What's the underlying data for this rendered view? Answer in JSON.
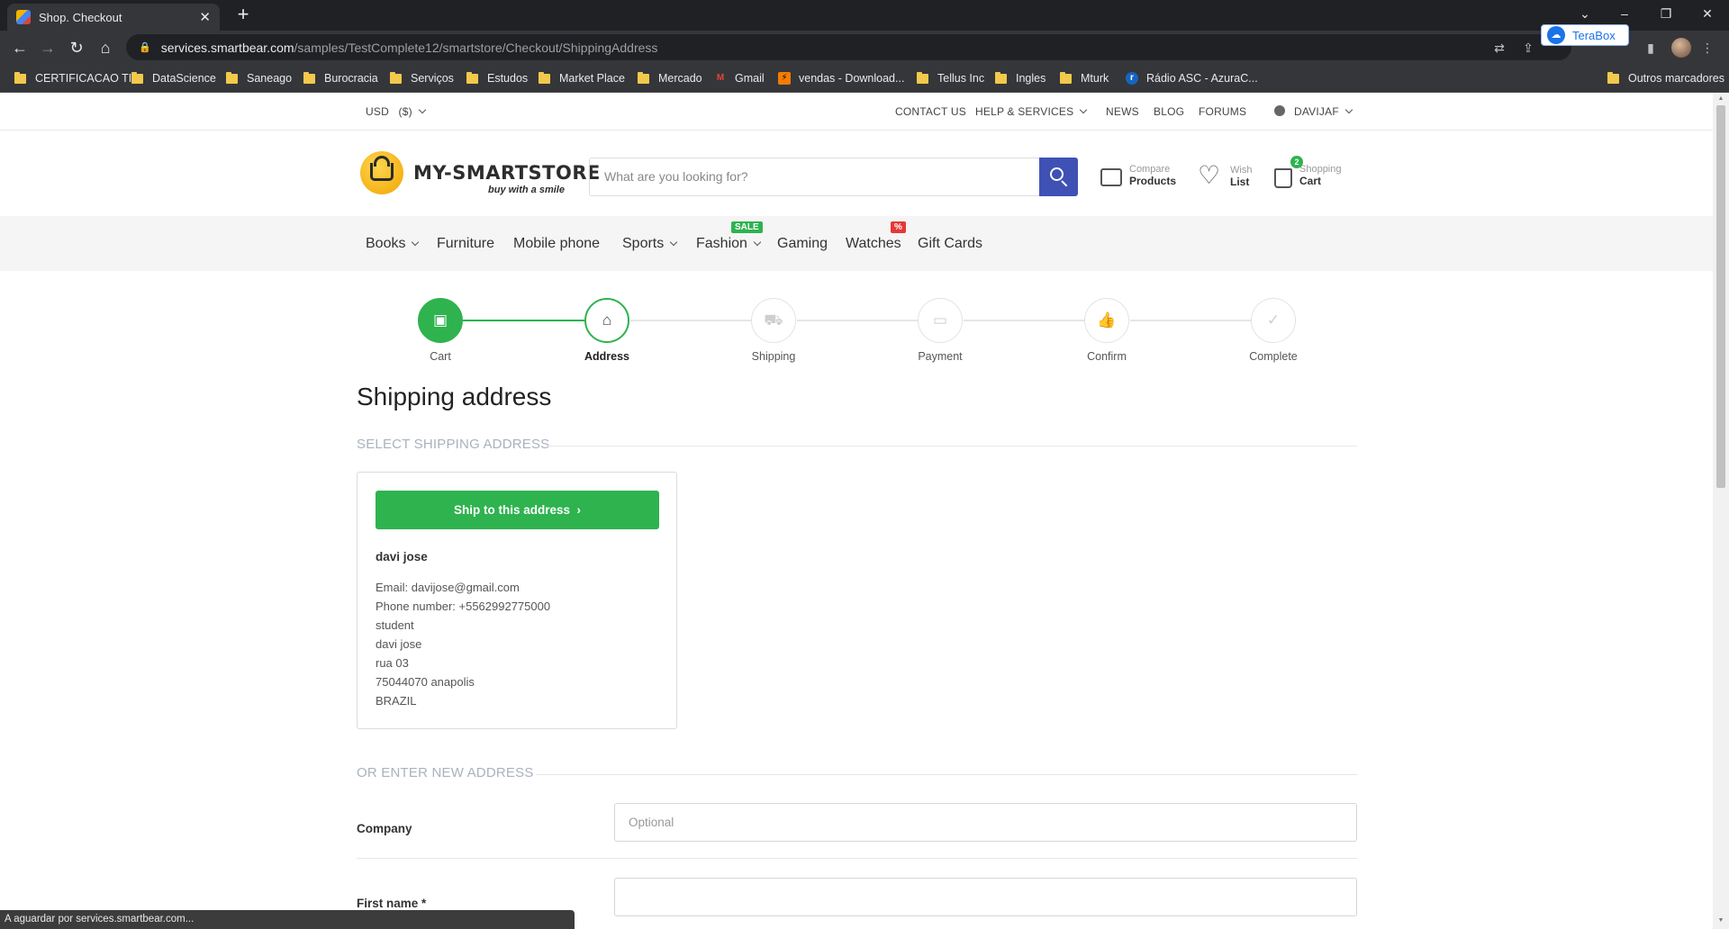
{
  "browser": {
    "tab_title": "Shop. Checkout",
    "url_host": "services.smartbear.com",
    "url_path": "/samples/TestComplete12/smartstore/Checkout/ShippingAddress",
    "extension_label": "TeraBox",
    "status_text": "A aguardar por services.smartbear.com...",
    "bookmarks": [
      {
        "label": "CERTIFICACAO TI",
        "icon": "folder-icon"
      },
      {
        "label": "DataScience",
        "icon": "folder-icon"
      },
      {
        "label": "Saneago",
        "icon": "folder-icon"
      },
      {
        "label": "Burocracia",
        "icon": "folder-icon"
      },
      {
        "label": "Serviços",
        "icon": "folder-icon"
      },
      {
        "label": "Estudos",
        "icon": "folder-icon"
      },
      {
        "label": "Market Place",
        "icon": "folder-icon"
      },
      {
        "label": "Mercado",
        "icon": "folder-icon"
      },
      {
        "label": "Gmail",
        "icon": "gmail-icon"
      },
      {
        "label": "vendas - Download...",
        "icon": "site-icon"
      },
      {
        "label": "Tellus Inc",
        "icon": "folder-icon"
      },
      {
        "label": "Ingles",
        "icon": "folder-icon"
      },
      {
        "label": "Mturk",
        "icon": "folder-icon"
      },
      {
        "label": "Rádio ASC - AzuraC...",
        "icon": "radio-icon"
      }
    ],
    "other_bookmarks": "Outros marcadores"
  },
  "topbar": {
    "currency": "USD",
    "currency_symbol": "($)",
    "contact_us": "CONTACT US",
    "help_services": "HELP & SERVICES",
    "news": "NEWS",
    "blog": "BLOG",
    "forums": "FORUMS",
    "user": "DAVIJAF"
  },
  "header": {
    "logo_name": "MY-SMARTSTORE",
    "logo_tagline": "buy with a smile",
    "search_placeholder": "What are you looking for?",
    "compare_top": "Compare",
    "compare_bottom": "Products",
    "wish_top": "Wish",
    "wish_bottom": "List",
    "cart_top": "Shopping",
    "cart_bottom": "Cart",
    "cart_count": "2"
  },
  "nav": {
    "books": "Books",
    "furniture": "Furniture",
    "mobile": "Mobile phone",
    "sports": "Sports",
    "fashion": "Fashion",
    "fashion_badge": "SALE",
    "gaming": "Gaming",
    "watches": "Watches",
    "watches_badge": "%",
    "gift_cards": "Gift Cards",
    "sale_color": "#2eb34f",
    "percent_color": "#e53935"
  },
  "steps": {
    "cart": "Cart",
    "address": "Address",
    "shipping": "Shipping",
    "payment": "Payment",
    "confirm": "Confirm",
    "complete": "Complete"
  },
  "main": {
    "title": "Shipping address",
    "select_section": "SELECT SHIPPING ADDRESS",
    "ship_button": "Ship to this address",
    "address": {
      "name": "davi jose",
      "email": "Email: davijose@gmail.com",
      "phone": "Phone number: +5562992775000",
      "company": "student",
      "contact": "davi jose",
      "street": "rua 03",
      "zip_city": "75044070 anapolis",
      "country": "BRAZIL"
    },
    "new_section": "OR ENTER NEW ADDRESS",
    "company_label": "Company",
    "company_placeholder": "Optional",
    "first_name_label": "First name *",
    "first_name_value": ""
  },
  "colors": {
    "accent_green": "#2eb34f",
    "search_blue": "#3f51b5"
  }
}
